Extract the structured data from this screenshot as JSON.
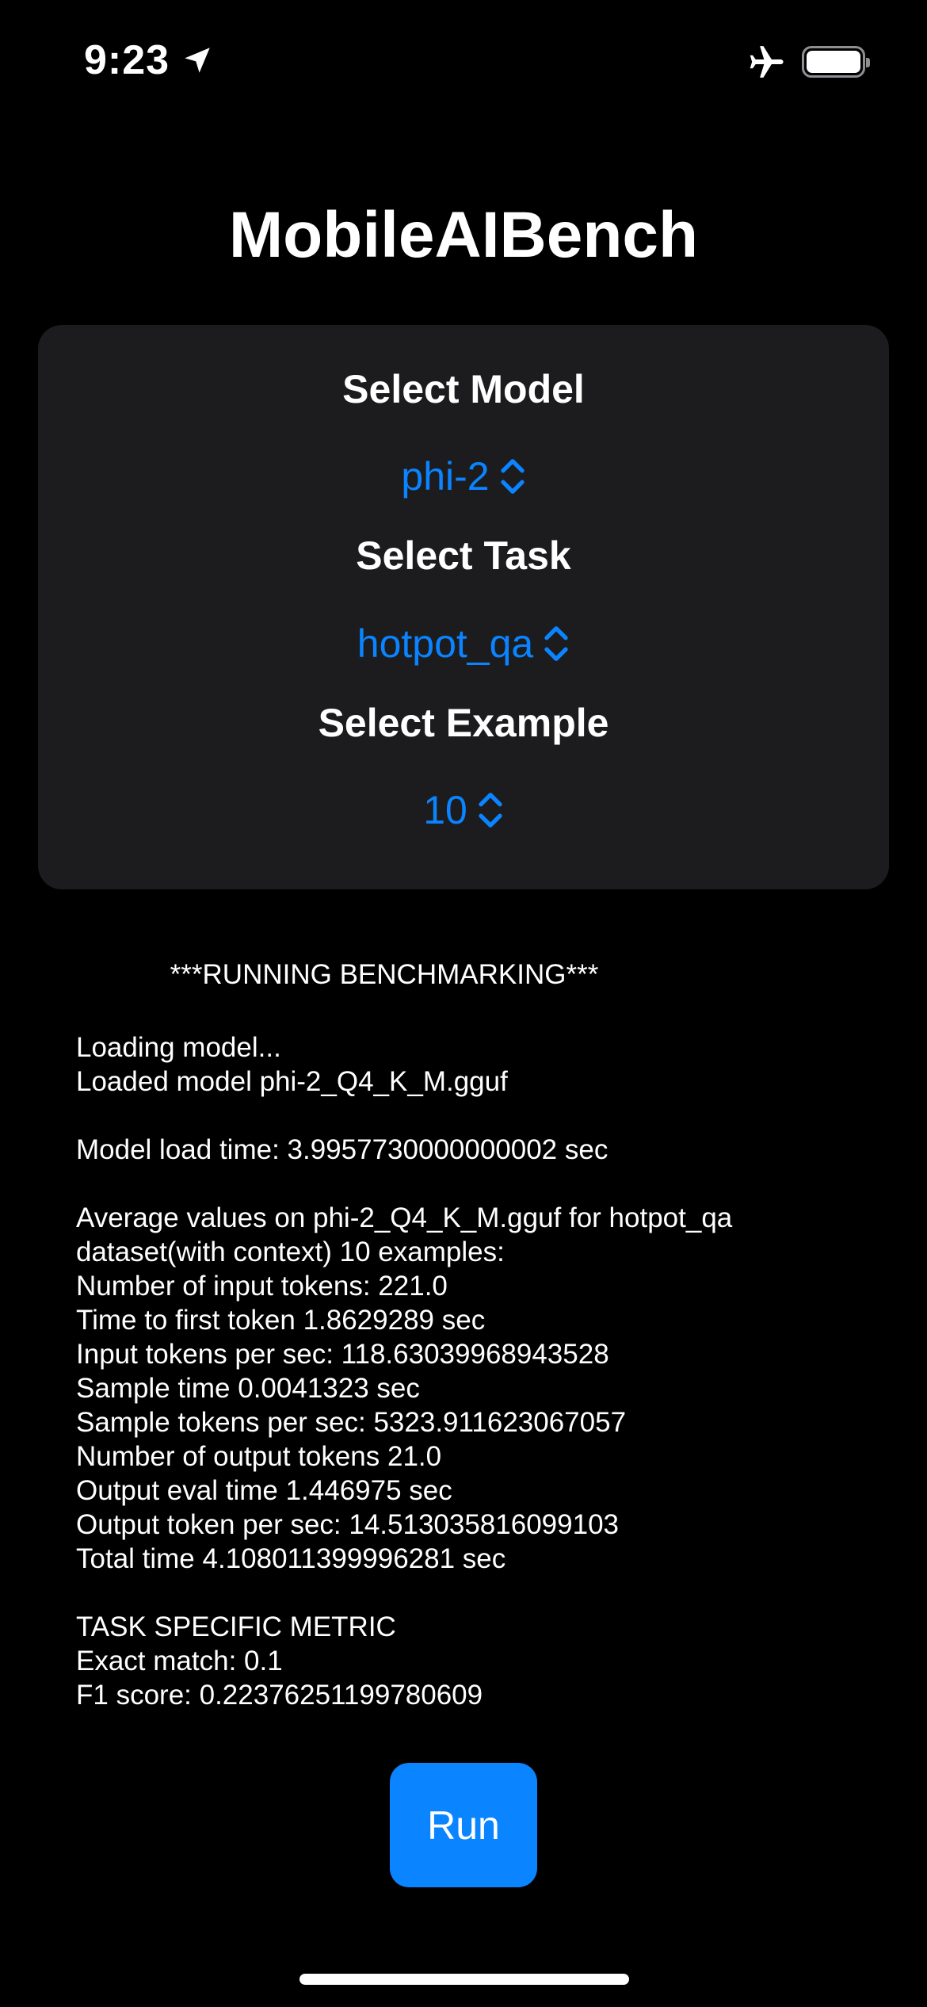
{
  "status_bar": {
    "time": "9:23",
    "icons": [
      "location-arrow-icon",
      "airplane-mode-icon",
      "battery-icon"
    ]
  },
  "app": {
    "title": "MobileAIBench"
  },
  "selectors": {
    "model": {
      "label": "Select Model",
      "value": "phi-2"
    },
    "task": {
      "label": "Select Task",
      "value": "hotpot_qa"
    },
    "example": {
      "label": "Select Example",
      "value": "10"
    }
  },
  "output": {
    "header": "***RUNNING BENCHMARKING***",
    "lines": [
      "Loading model...",
      "Loaded model phi-2_Q4_K_M.gguf",
      "",
      "Model load time: 3.9957730000000002 sec",
      "",
      "Average values on phi-2_Q4_K_M.gguf for hotpot_qa",
      "dataset(with context) 10 examples:",
      "Number of input tokens: 221.0",
      "Time to first token 1.8629289 sec",
      "Input tokens per sec: 118.63039968943528",
      "Sample time 0.0041323 sec",
      "Sample tokens per sec: 5323.911623067057",
      "Number of output tokens 21.0",
      "Output eval time 1.446975 sec",
      "Output token per sec: 14.513035816099103",
      "Total time 4.108011399996281 sec",
      "",
      "TASK SPECIFIC METRIC",
      "Exact match: 0.1",
      "F1 score: 0.22376251199780609"
    ]
  },
  "actions": {
    "run_label": "Run"
  },
  "colors": {
    "background": "#000000",
    "card": "#1c1c1e",
    "accent": "#0a84ff",
    "text": "#ffffff"
  }
}
